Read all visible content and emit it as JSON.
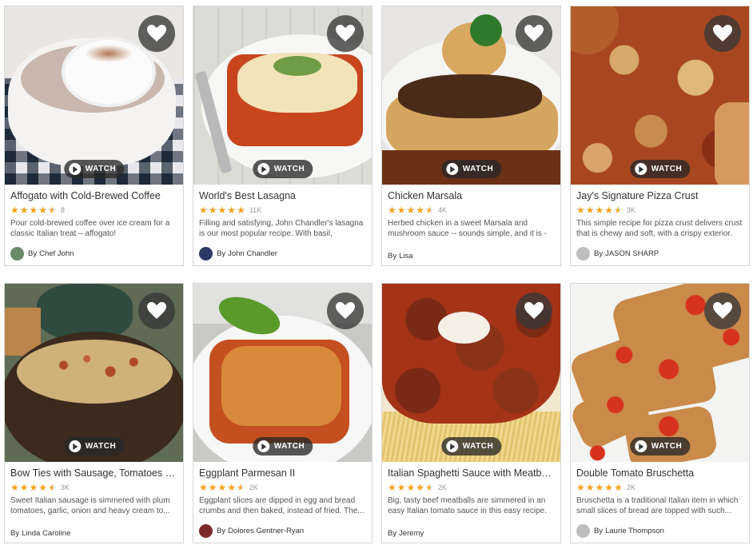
{
  "cards": [
    {
      "title": "Affogato with Cold-Brewed Coffee",
      "rating": 4.5,
      "count": "8",
      "desc": "Pour cold-brewed coffee over ice cream for a classic Italian treat – affogato!",
      "author_prefix": "By",
      "author": "Chef John",
      "watch": "WATCH",
      "avatar": true,
      "avatar_color": "#6b8a6a",
      "photo": "affogato"
    },
    {
      "title": "World's Best Lasagna",
      "rating": 5,
      "count": "11K",
      "desc": "Filling and satisfying, John Chandler's lasagna is our most popular recipe. With basil, sausage,...",
      "author_prefix": "By",
      "author": "John Chandler",
      "watch": "WATCH",
      "avatar": true,
      "avatar_color": "#2b3a66",
      "photo": "lasagna"
    },
    {
      "title": "Chicken Marsala",
      "rating": 4.5,
      "count": "4K",
      "desc": "Herbed chicken in a sweet Marsala and mushroom sauce -- sounds simple, and it is --...",
      "author_prefix": "By",
      "author": "Lisa",
      "watch": "WATCH",
      "avatar": false,
      "photo": "marsala"
    },
    {
      "title": "Jay's Signature Pizza Crust",
      "rating": 4.5,
      "count": "3K",
      "desc": "This simple recipe for pizza crust delivers crust that is chewy and soft, with a crispy exterior.",
      "author_prefix": "By",
      "author": "JASON SHARP",
      "watch": "WATCH",
      "avatar": true,
      "avatar_color": "#bdbdbd",
      "photo": "pizza"
    },
    {
      "title": "Bow Ties with Sausage, Tomatoes and Cream",
      "rating": 4.5,
      "count": "3K",
      "desc": "Sweet Italian sausage is simmered with plum tomatoes, garlic, onion and heavy cream to...",
      "author_prefix": "By",
      "author": "Linda Caroline",
      "watch": "WATCH",
      "avatar": false,
      "photo": "bowties"
    },
    {
      "title": "Eggplant Parmesan II",
      "rating": 4.5,
      "count": "2K",
      "desc": "Eggplant slices are dipped in egg and bread crumbs and then baked, instead of fried. The...",
      "author_prefix": "By",
      "author": "Dolores Gentner-Ryan",
      "watch": "WATCH",
      "avatar": true,
      "avatar_color": "#7a2a2a",
      "photo": "eggplant"
    },
    {
      "title": "Italian Spaghetti Sauce with Meatballs",
      "rating": 4.5,
      "count": "2K",
      "desc": "Big, tasty beef meatballs are simmered in an easy Italian tomato sauce in this easy recipe.",
      "author_prefix": "By",
      "author": "Jeremy",
      "watch": "WATCH",
      "avatar": false,
      "photo": "meatballs"
    },
    {
      "title": "Double Tomato Bruschetta",
      "rating": 5,
      "count": "2K",
      "desc": "Bruschetta is a traditional Italian item in which small slices of bread are topped with such...",
      "author_prefix": "By",
      "author": "Laurie Thompson",
      "watch": "WATCH",
      "avatar": true,
      "avatar_color": "#bdbdbd",
      "photo": "bruschetta"
    }
  ],
  "colors": {
    "star": "#f7a11a",
    "heart_bg": "#373737"
  }
}
